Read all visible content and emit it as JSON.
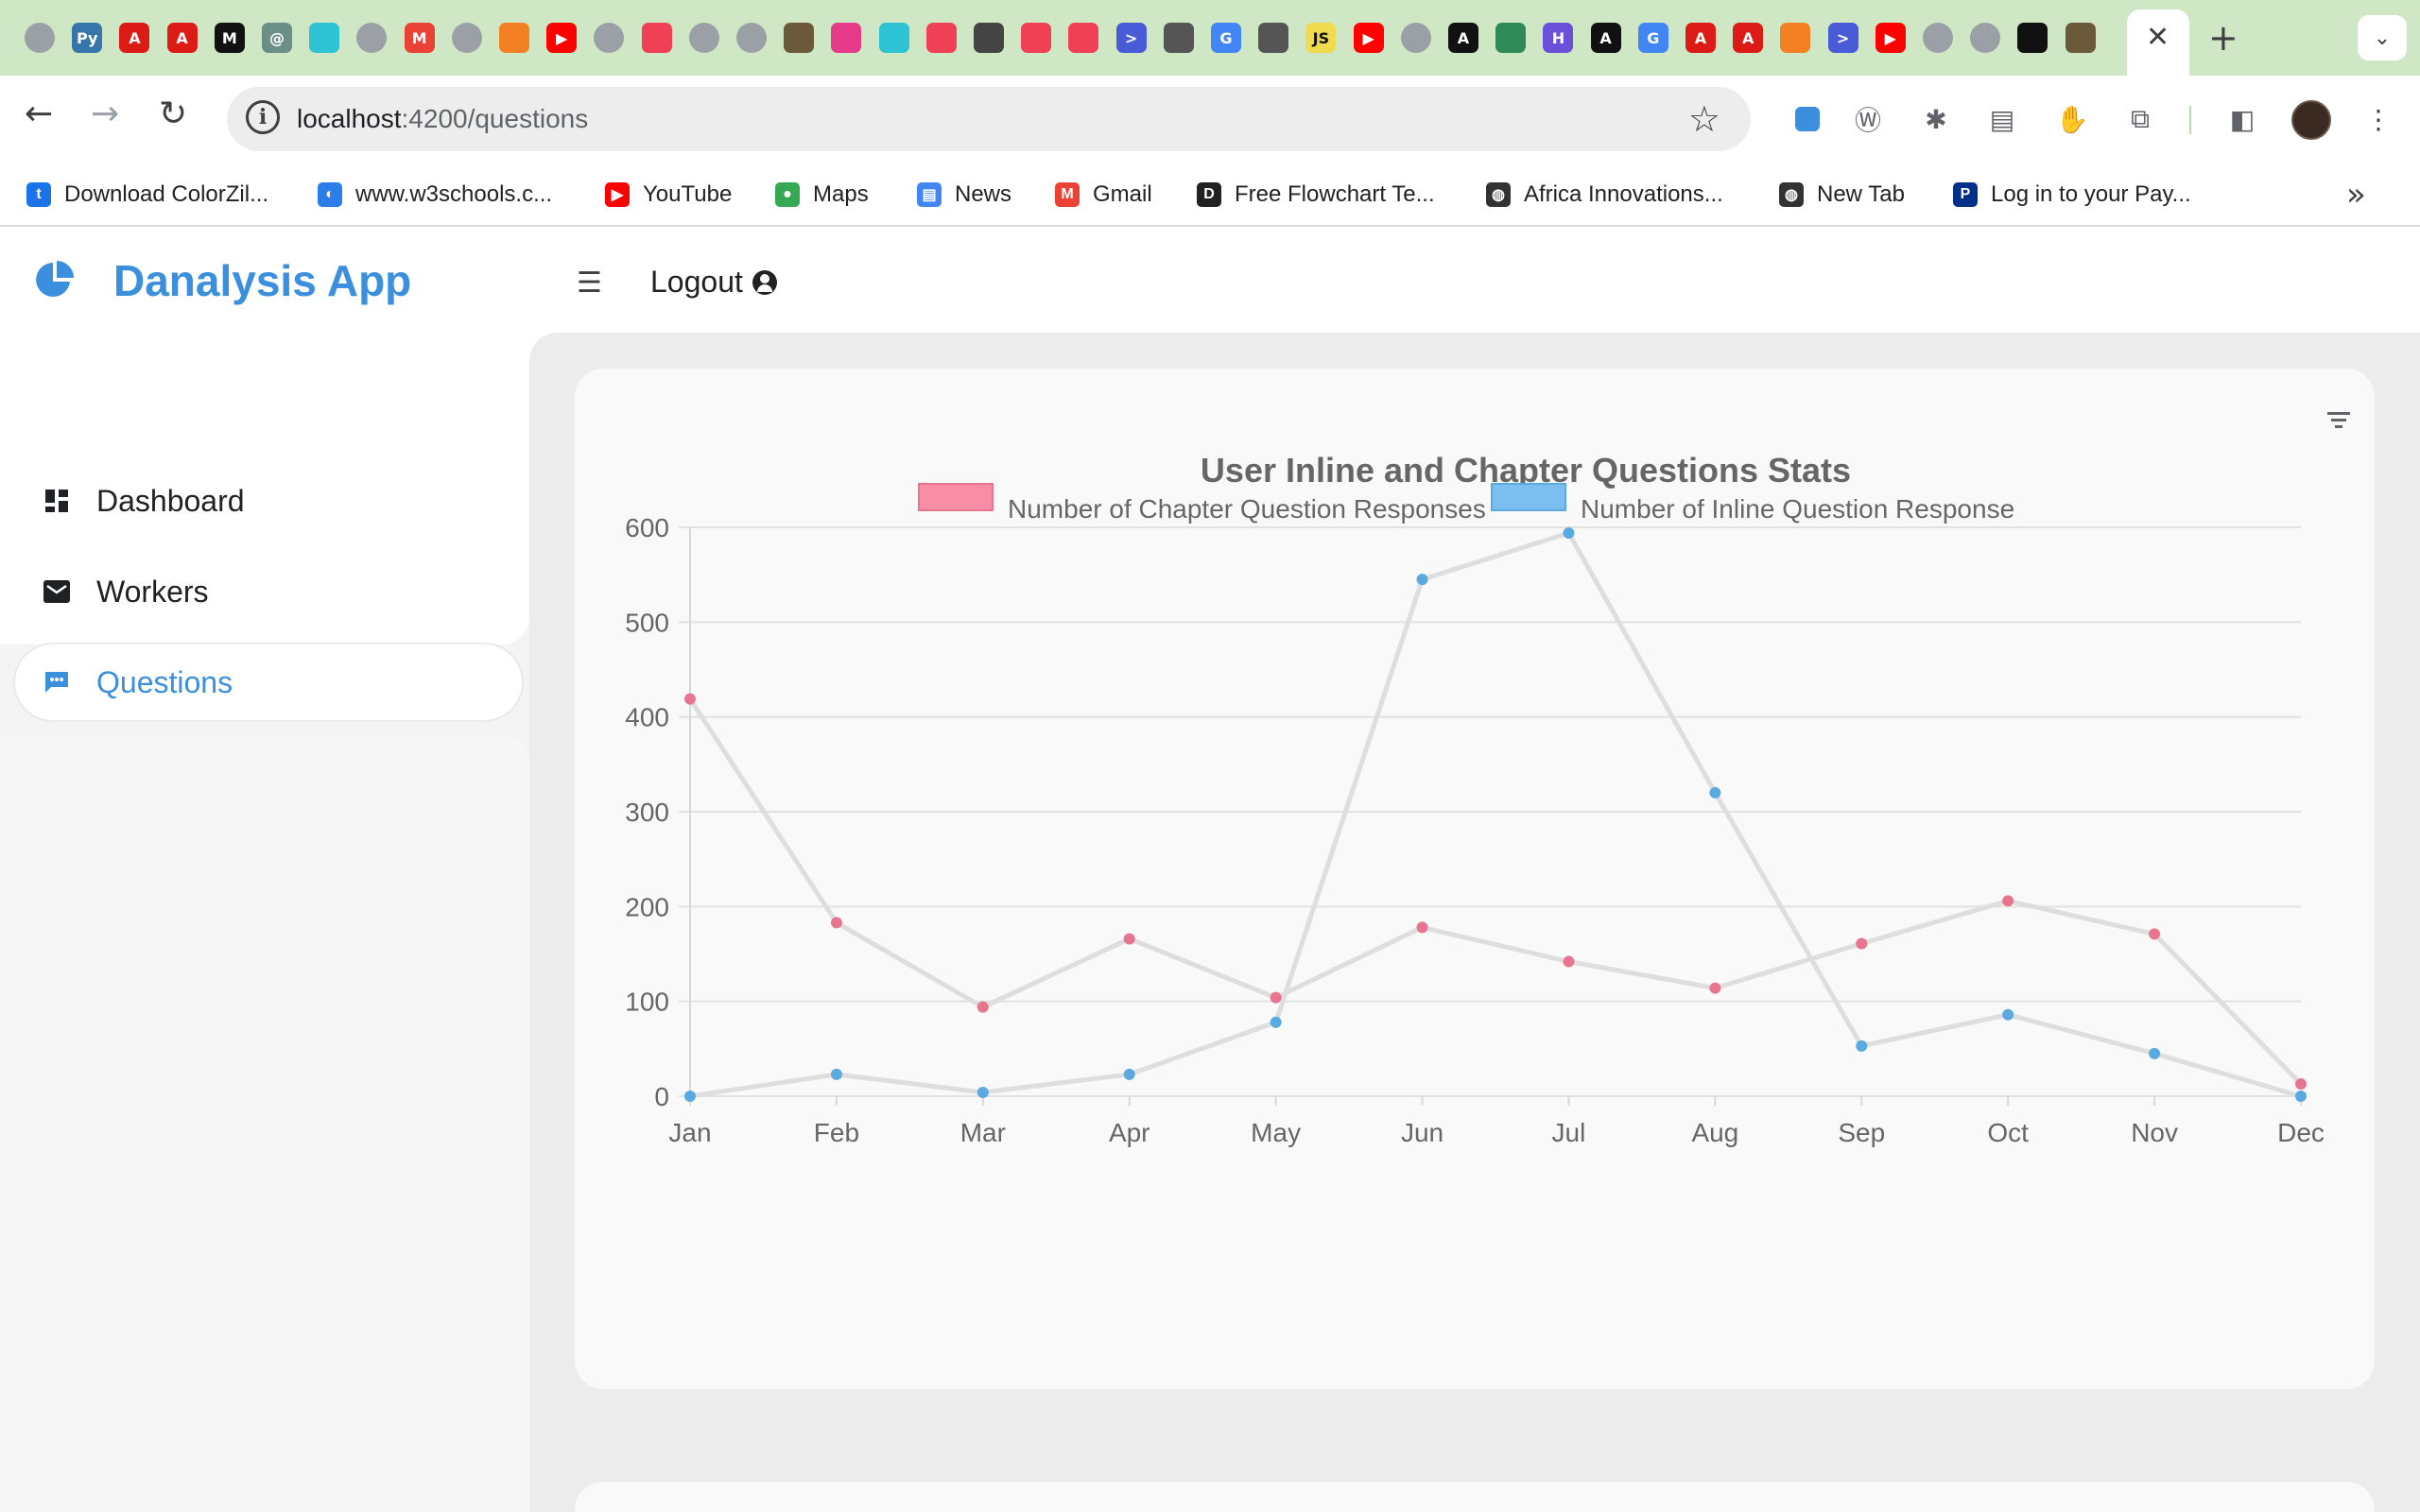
{
  "browser": {
    "tab_icons": [
      {
        "name": "globe-icon",
        "bg": "#9aa0a6",
        "glyph": ""
      },
      {
        "name": "python-icon",
        "bg": "#3776ab",
        "glyph": "Py"
      },
      {
        "name": "angular-icon",
        "bg": "#dd1b16",
        "glyph": "A"
      },
      {
        "name": "angular-icon",
        "bg": "#dd1b16",
        "glyph": "A"
      },
      {
        "name": "medium-icon",
        "bg": "#111111",
        "glyph": "M"
      },
      {
        "name": "openai-icon",
        "bg": "#6b8f86",
        "glyph": "@"
      },
      {
        "name": "cube-icon",
        "bg": "#2ec4d6",
        "glyph": ""
      },
      {
        "name": "github-icon",
        "bg": "#9aa0a6",
        "glyph": ""
      },
      {
        "name": "gmail-icon",
        "bg": "#ea4335",
        "glyph": "M"
      },
      {
        "name": "github-icon",
        "bg": "#9aa0a6",
        "glyph": ""
      },
      {
        "name": "stackoverflow-icon",
        "bg": "#f48024",
        "glyph": ""
      },
      {
        "name": "youtube-icon",
        "bg": "#ff0000",
        "glyph": "▶"
      },
      {
        "name": "github-icon",
        "bg": "#9aa0a6",
        "glyph": ""
      },
      {
        "name": "pocket-icon",
        "bg": "#ef4056",
        "glyph": ""
      },
      {
        "name": "github-icon",
        "bg": "#9aa0a6",
        "glyph": ""
      },
      {
        "name": "globe-icon",
        "bg": "#9aa0a6",
        "glyph": ""
      },
      {
        "name": "photo-icon",
        "bg": "#6b5a3a",
        "glyph": ""
      },
      {
        "name": "cube-icon",
        "bg": "#e63b8a",
        "glyph": ""
      },
      {
        "name": "cube-icon",
        "bg": "#2ec4d6",
        "glyph": ""
      },
      {
        "name": "pocket-icon",
        "bg": "#ef4056",
        "glyph": ""
      },
      {
        "name": "book-icon",
        "bg": "#444444",
        "glyph": ""
      },
      {
        "name": "pocket-icon",
        "bg": "#ef4056",
        "glyph": ""
      },
      {
        "name": "pocket-icon",
        "bg": "#ef4056",
        "glyph": ""
      },
      {
        "name": "terminal-icon",
        "bg": "#4a5bd8",
        "glyph": ">"
      },
      {
        "name": "book-icon",
        "bg": "#555555",
        "glyph": ""
      },
      {
        "name": "google-icon",
        "bg": "#4285f4",
        "glyph": "G"
      },
      {
        "name": "book-icon",
        "bg": "#555555",
        "glyph": ""
      },
      {
        "name": "javascript-icon",
        "bg": "#f0db4f",
        "glyph": "JS"
      },
      {
        "name": "youtube-icon",
        "bg": "#ff0000",
        "glyph": "▶"
      },
      {
        "name": "github-icon",
        "bg": "#9aa0a6",
        "glyph": ""
      },
      {
        "name": "angular-dark-icon",
        "bg": "#111111",
        "glyph": "A"
      },
      {
        "name": "plugin-icon",
        "bg": "#2e8b57",
        "glyph": ""
      },
      {
        "name": "h-icon",
        "bg": "#6a4fd8",
        "glyph": "H"
      },
      {
        "name": "angular-dark-icon",
        "bg": "#111111",
        "glyph": "A"
      },
      {
        "name": "google-icon",
        "bg": "#4285f4",
        "glyph": "G"
      },
      {
        "name": "angular-icon",
        "bg": "#dd1b16",
        "glyph": "A"
      },
      {
        "name": "angular-icon",
        "bg": "#dd1b16",
        "glyph": "A"
      },
      {
        "name": "stackoverflow-icon",
        "bg": "#f48024",
        "glyph": ""
      },
      {
        "name": "terminal-icon",
        "bg": "#4a5bd8",
        "glyph": ">"
      },
      {
        "name": "youtube-icon",
        "bg": "#ff0000",
        "glyph": "▶"
      },
      {
        "name": "github-icon",
        "bg": "#9aa0a6",
        "glyph": ""
      },
      {
        "name": "github-icon",
        "bg": "#9aa0a6",
        "glyph": ""
      },
      {
        "name": "codepen-icon",
        "bg": "#111111",
        "glyph": ""
      },
      {
        "name": "photo-icon",
        "bg": "#6b5a3a",
        "glyph": ""
      }
    ],
    "url_host": "localhost",
    "url_path": ":4200/questions",
    "bookmarks": [
      {
        "label": "Download ColorZil...",
        "icon": "colorzilla-icon",
        "bg": "#1a73e8",
        "glyph": "t"
      },
      {
        "label": "www.w3schools.c...",
        "icon": "w3schools-icon",
        "bg": "#2b7de9",
        "glyph": "◐"
      },
      {
        "label": "YouTube",
        "icon": "youtube-icon",
        "bg": "#ff0000",
        "glyph": "▶"
      },
      {
        "label": "Maps",
        "icon": "maps-icon",
        "bg": "#34a853",
        "glyph": "●"
      },
      {
        "label": "News",
        "icon": "news-icon",
        "bg": "#4285f4",
        "glyph": "▤"
      },
      {
        "label": "Gmail",
        "icon": "gmail-icon",
        "bg": "#ea4335",
        "glyph": "M"
      },
      {
        "label": "Free Flowchart Te...",
        "icon": "flowchart-icon",
        "bg": "#222222",
        "glyph": "D"
      },
      {
        "label": "Africa Innovations...",
        "icon": "globe-icon",
        "bg": "#333333",
        "glyph": "◍"
      },
      {
        "label": "New Tab",
        "icon": "globe-icon",
        "bg": "#333333",
        "glyph": "◍"
      },
      {
        "label": "Log in to your Pay...",
        "icon": "paypal-icon",
        "bg": "#003087",
        "glyph": "P"
      }
    ]
  },
  "app": {
    "brand": "Danalysis App",
    "logout_label": "Logout",
    "nav": [
      {
        "label": "Dashboard",
        "icon": "dashboard-icon",
        "active": false
      },
      {
        "label": "Workers",
        "icon": "mail-icon",
        "active": false
      },
      {
        "label": "Questions",
        "icon": "chat-icon",
        "active": true
      }
    ],
    "colors": {
      "accent": "#3b8fdc",
      "chapter_series": "#f78da7",
      "inline_series": "#7cbef0",
      "line": "#dedede"
    }
  },
  "chart_data": {
    "type": "line",
    "title": "User Inline and Chapter Questions Stats",
    "categories": [
      "Jan",
      "Feb",
      "Mar",
      "Apr",
      "May",
      "Jun",
      "Jul",
      "Aug",
      "Sep",
      "Oct",
      "Nov",
      "Dec"
    ],
    "series": [
      {
        "name": "Number of Chapter Question Responses",
        "color": "#f78da7",
        "point_color": "#e8758f",
        "values": [
          419,
          183,
          94,
          166,
          104,
          178,
          142,
          114,
          161,
          206,
          171,
          13
        ]
      },
      {
        "name": "Number of Inline Question Response",
        "color": "#7cbef0",
        "point_color": "#5aaae0",
        "values": [
          0,
          23,
          4,
          23,
          78,
          545,
          594,
          320,
          53,
          86,
          45,
          0
        ]
      }
    ],
    "ylim": [
      0,
      600
    ],
    "yticks": [
      0,
      100,
      200,
      300,
      400,
      500,
      600
    ],
    "grid": true,
    "legend_position": "top"
  }
}
